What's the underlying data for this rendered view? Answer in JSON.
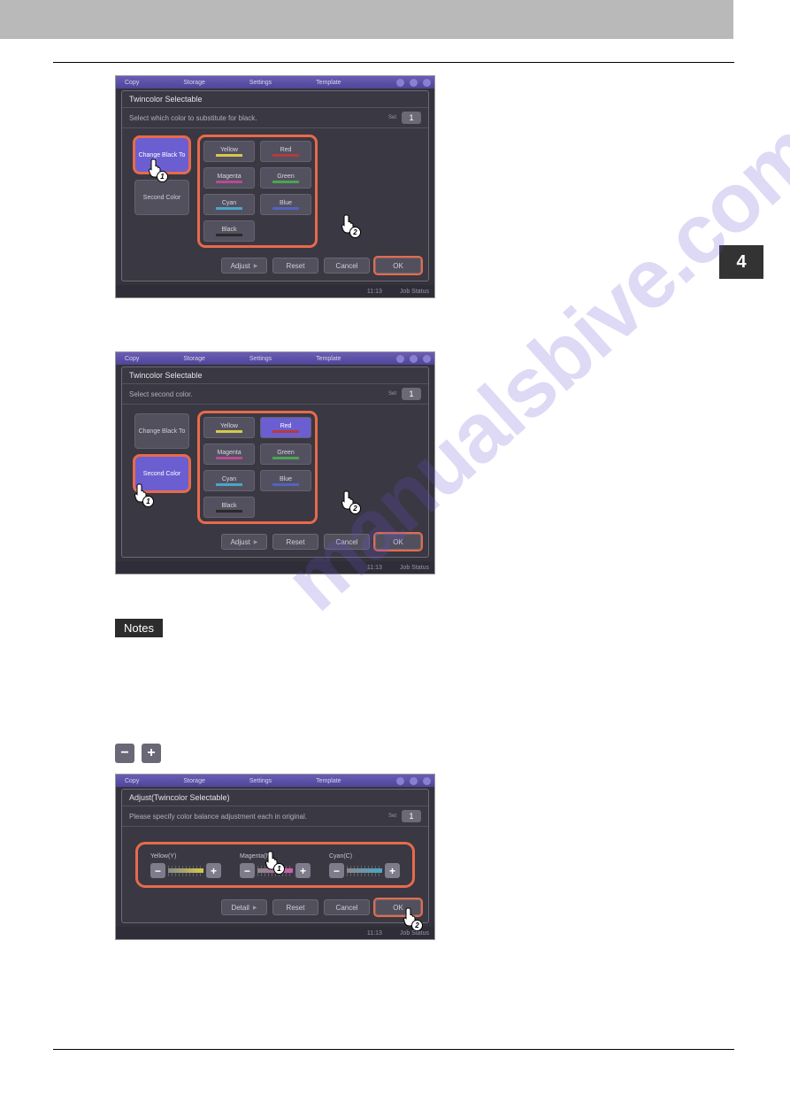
{
  "page_tab": "4",
  "watermark_text": "manualsbive.com",
  "device_top_tabs": [
    "Copy",
    "Storage",
    "Settings",
    "Template"
  ],
  "footer_items": {
    "time": "11:13",
    "status": "Job Status"
  },
  "buttons": {
    "adjust": "Adjust",
    "reset": "Reset",
    "cancel": "Cancel",
    "ok": "OK",
    "detail": "Detail"
  },
  "sidebtn_labels": {
    "change_black": "Change Black To",
    "second_color": "Second Color"
  },
  "set_label": "Set",
  "set_value": "1",
  "colors": [
    {
      "name": "Yellow",
      "hex": "#d6c84a"
    },
    {
      "name": "Red",
      "hex": "#b43c3c"
    },
    {
      "name": "Magenta",
      "hex": "#b44c92"
    },
    {
      "name": "Green",
      "hex": "#4aa552"
    },
    {
      "name": "Cyan",
      "hex": "#4aa5c8"
    },
    {
      "name": "Blue",
      "hex": "#5262c0"
    },
    {
      "name": "Black",
      "hex": "#2a2a2a"
    }
  ],
  "screenshot1": {
    "dlg_title": "Twincolor Selectable",
    "dlg_sub": "Select which color to substitute for black.",
    "cb_selected": true,
    "sc_selected": false,
    "cb_highlighted": true,
    "sc_highlighted": false,
    "selected_color_index": -1
  },
  "screenshot2": {
    "dlg_title": "Twincolor Selectable",
    "dlg_sub": "Select second color.",
    "cb_selected": false,
    "sc_selected": true,
    "cb_highlighted": false,
    "sc_highlighted": true,
    "selected_color_index": 1
  },
  "notes_label": "Notes",
  "inline_buttons": {
    "minus": "−",
    "plus": "+"
  },
  "screenshot3": {
    "dlg_title": "Adjust(Twincolor Selectable)",
    "dlg_sub": "Please specify color balance adjustment each in original.",
    "channels": [
      {
        "label": "Yellow(Y)",
        "grad": "linear-gradient(90deg,#888,#d6c84a)"
      },
      {
        "label": "Magenta(M)",
        "grad": "linear-gradient(90deg,#888,#d25ab0)"
      },
      {
        "label": "Cyan(C)",
        "grad": "linear-gradient(90deg,#888,#4aa5c8)"
      }
    ]
  }
}
